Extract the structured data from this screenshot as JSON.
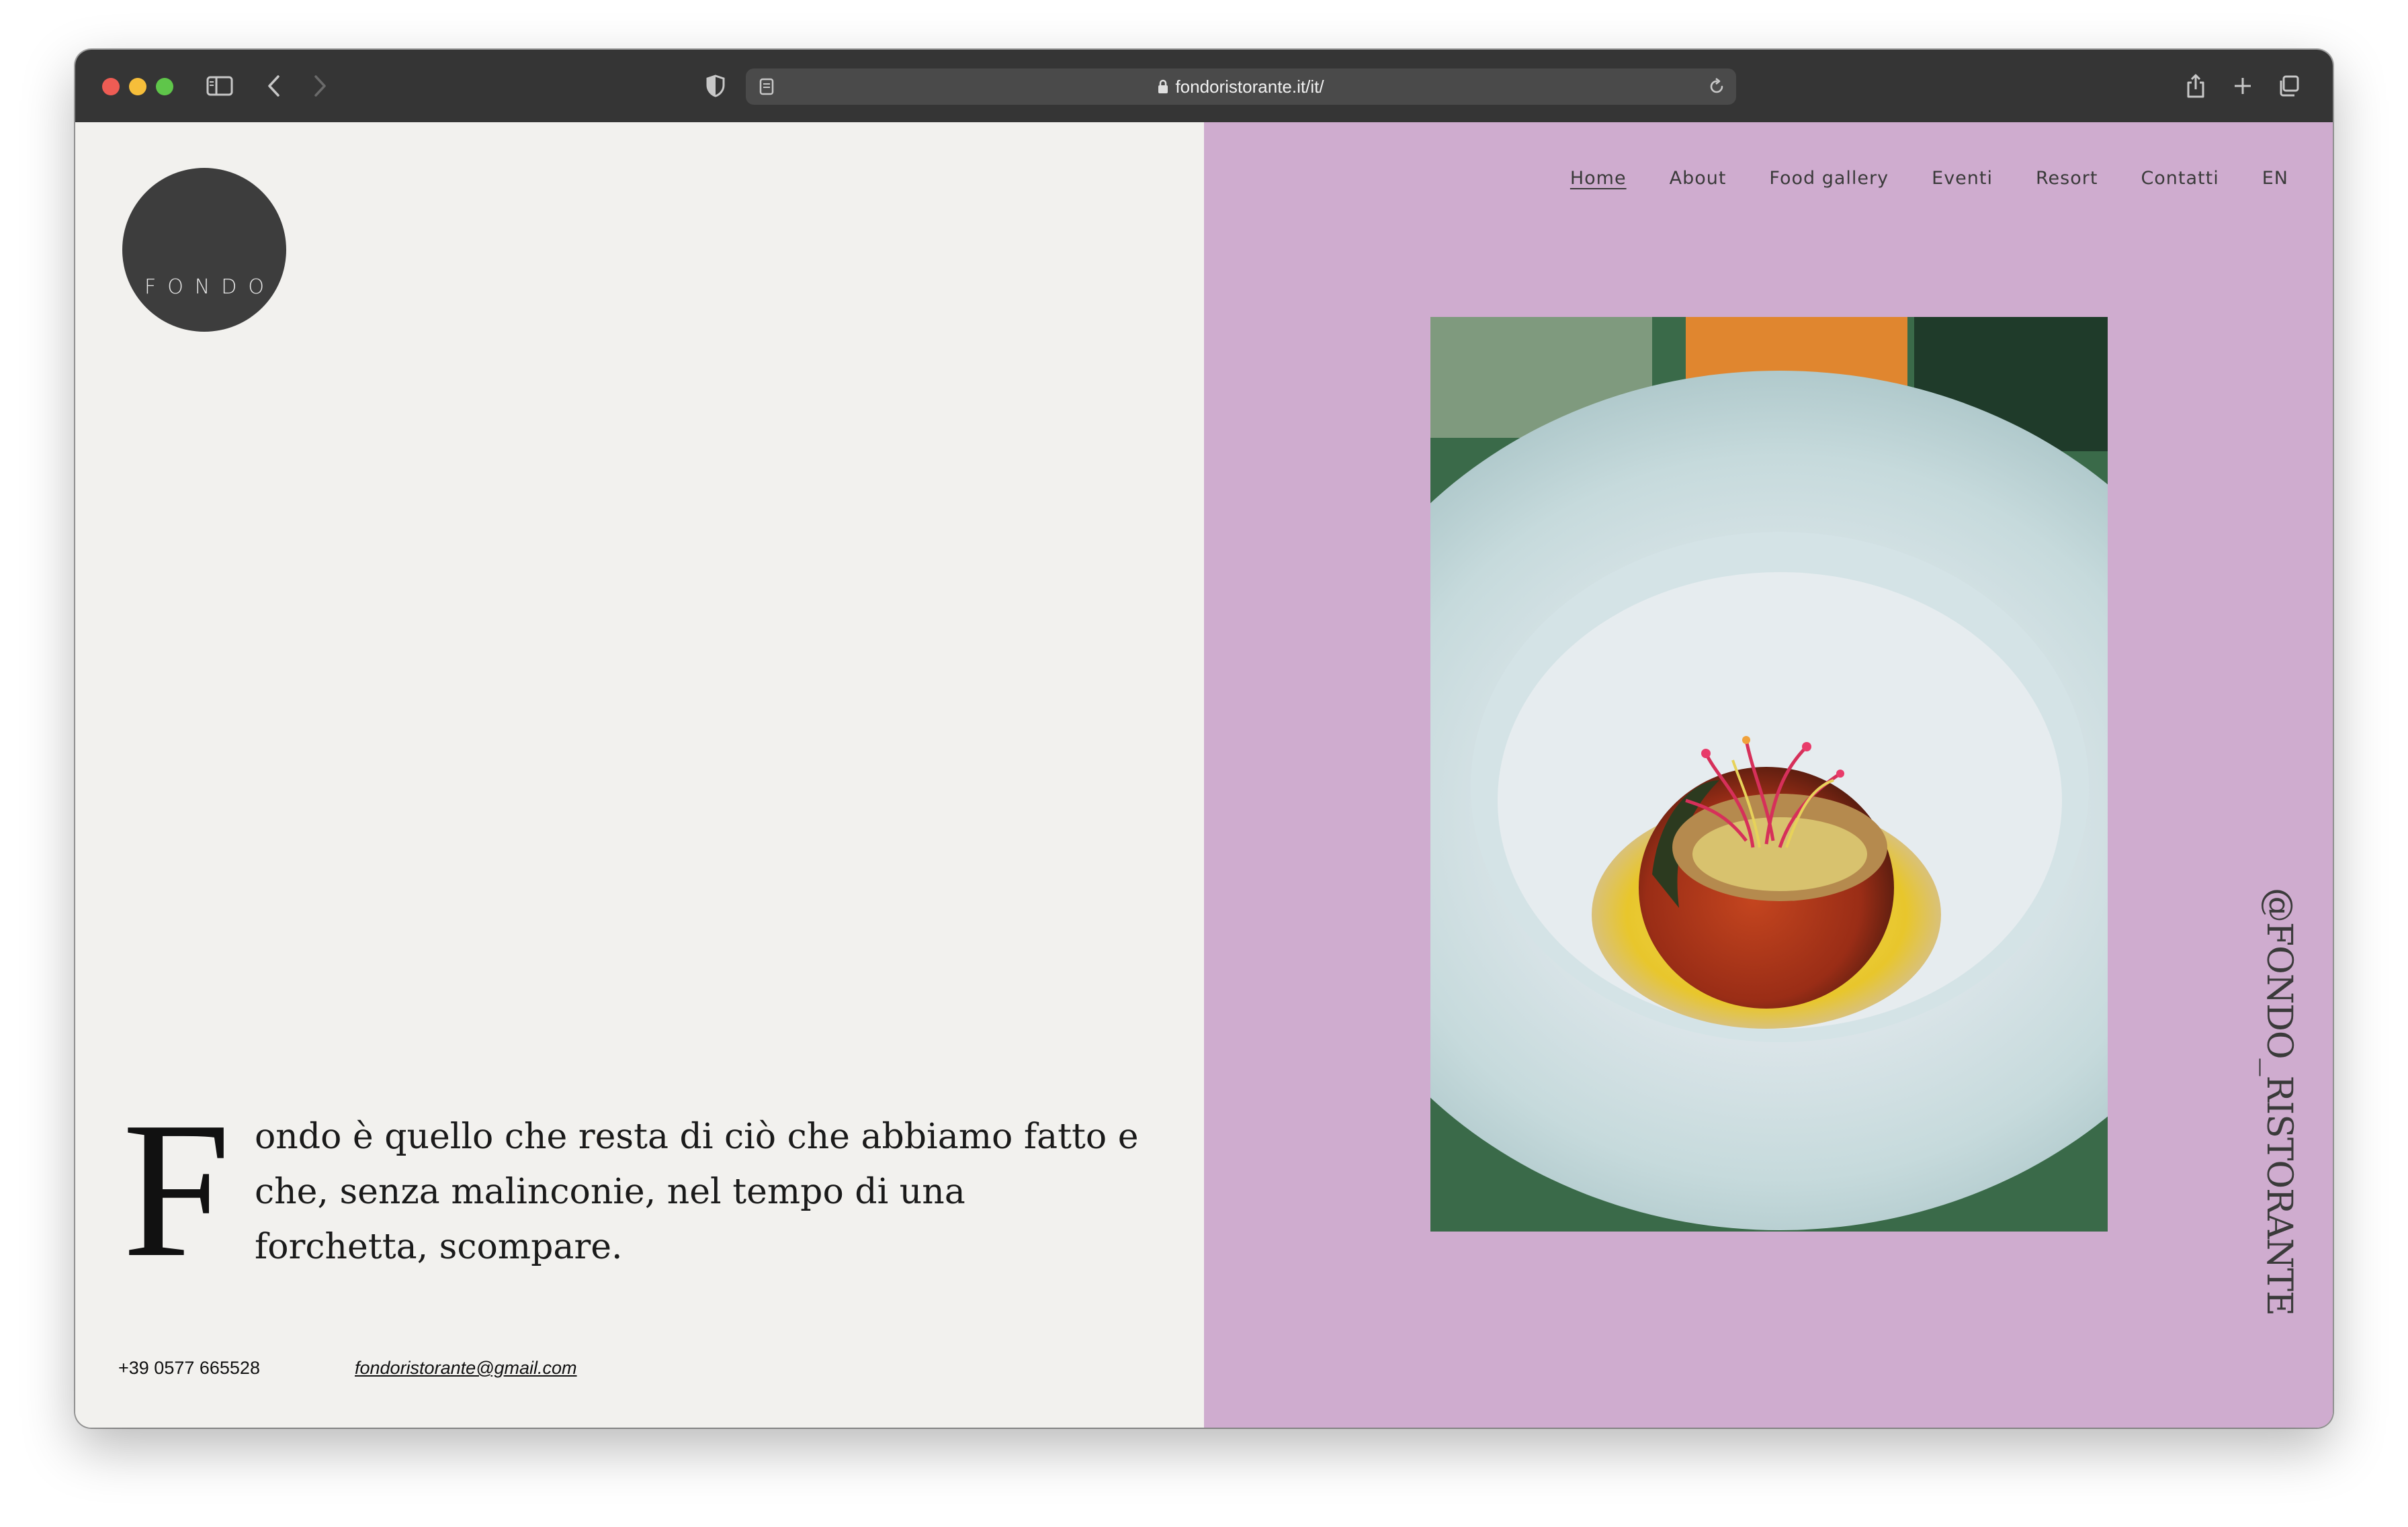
{
  "browser": {
    "url": "fondoristorante.it/it/"
  },
  "site": {
    "logo_text": "FONDO",
    "nav": [
      {
        "label": "Home"
      },
      {
        "label": "About"
      },
      {
        "label": "Food gallery"
      },
      {
        "label": "Eventi"
      },
      {
        "label": "Resort"
      },
      {
        "label": "Contatti"
      },
      {
        "label": "EN"
      }
    ],
    "intro": {
      "drop_cap": "F",
      "text": "ondo è quello che resta di ciò che abbiamo fatto e che, senza malinconie, nel tempo di una forchetta, scompare."
    },
    "contact": {
      "phone": "+39 0577 665528",
      "email": "fondoristorante@gmail.com"
    },
    "instagram_handle": "@FONDO_RISTORANTE"
  },
  "colors": {
    "toolbar": "#353535",
    "left_panel": "#f2f1ee",
    "right_panel": "#cfaccf",
    "logo": "#3d3d3d"
  }
}
